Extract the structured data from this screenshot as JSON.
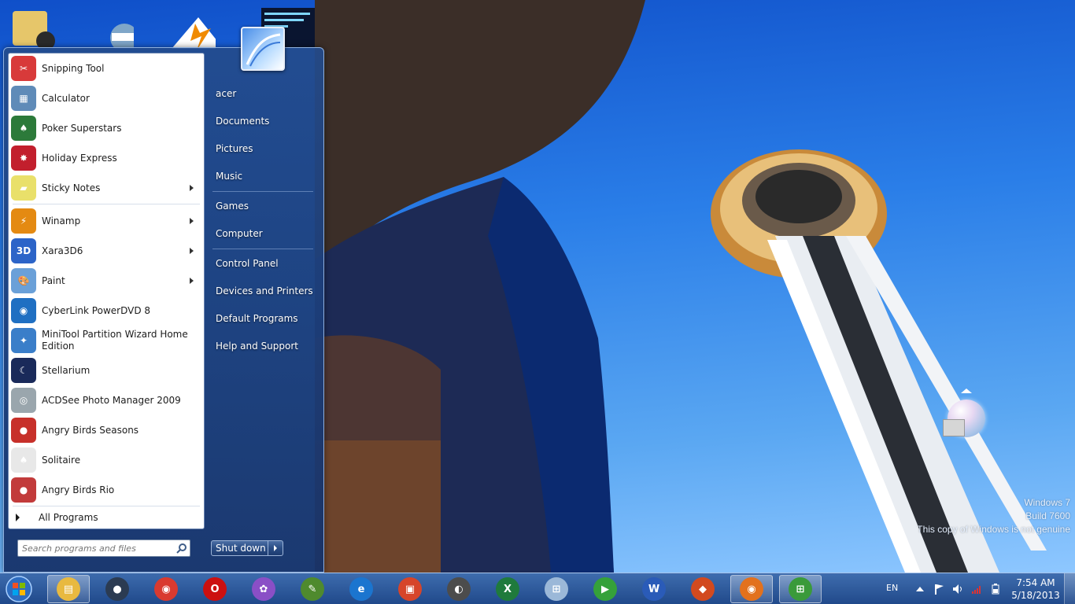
{
  "start_menu": {
    "programs": [
      {
        "label": "Snipping Tool",
        "icon": "scissors-icon",
        "color": "#d83a3a",
        "glyph": "✂",
        "submenu": false
      },
      {
        "label": "Calculator",
        "icon": "calculator-icon",
        "color": "#5f8bb8",
        "glyph": "▦",
        "submenu": false
      },
      {
        "label": "Poker Superstars",
        "icon": "poker-icon",
        "color": "#2c7a3a",
        "glyph": "♠",
        "submenu": false
      },
      {
        "label": "Holiday Express",
        "icon": "holiday-express-icon",
        "color": "#c21f2d",
        "glyph": "✸",
        "submenu": false
      },
      {
        "label": "Sticky Notes",
        "icon": "sticky-notes-icon",
        "color": "#e9e06a",
        "glyph": "▰",
        "submenu": true
      },
      {
        "label": "Winamp",
        "icon": "winamp-icon",
        "color": "#e48a12",
        "glyph": "⚡",
        "submenu": true
      },
      {
        "label": "Xara3D6",
        "icon": "xara3d-icon",
        "color": "#2c64c8",
        "glyph": "3D",
        "submenu": true
      },
      {
        "label": "Paint",
        "icon": "paint-icon",
        "color": "#6aa0d8",
        "glyph": "🎨",
        "submenu": true
      },
      {
        "label": "CyberLink PowerDVD 8",
        "icon": "powerdvd-icon",
        "color": "#1f6fc2",
        "glyph": "◉",
        "submenu": false
      },
      {
        "label": "MiniTool Partition Wizard Home Edition",
        "icon": "partition-wizard-icon",
        "color": "#3a7ec9",
        "glyph": "✦",
        "submenu": false
      },
      {
        "label": "Stellarium",
        "icon": "stellarium-icon",
        "color": "#1a2a5a",
        "glyph": "☾",
        "submenu": false
      },
      {
        "label": "ACDSee Photo Manager 2009",
        "icon": "acdsee-icon",
        "color": "#9aa6ad",
        "glyph": "◎",
        "submenu": false
      },
      {
        "label": "Angry Birds Seasons",
        "icon": "angry-birds-seasons-icon",
        "color": "#c7302a",
        "glyph": "●",
        "submenu": false
      },
      {
        "label": "Solitaire",
        "icon": "solitaire-icon",
        "color": "#e8e8e8",
        "glyph": "♠",
        "submenu": false
      },
      {
        "label": "Angry Birds Rio",
        "icon": "angry-birds-rio-icon",
        "color": "#c23b3b",
        "glyph": "●",
        "submenu": false
      }
    ],
    "all_programs_label": "All Programs",
    "search_placeholder": "Search programs and files",
    "right_items": [
      "acer",
      "Documents",
      "Pictures",
      "Music",
      "Games",
      "Computer",
      "Control Panel",
      "Devices and Printers",
      "Default Programs",
      "Help and Support"
    ],
    "shutdown_label": "Shut down"
  },
  "taskbar": {
    "pinned": [
      {
        "name": "explorer",
        "icon": "folder-icon",
        "color": "#e8b940",
        "glyph": "▤",
        "active": true
      },
      {
        "name": "media",
        "icon": "media-orb-icon",
        "color": "#2b3b52",
        "glyph": "●",
        "active": false
      },
      {
        "name": "chrome",
        "icon": "chrome-icon",
        "color": "#d93a2f",
        "glyph": "◉",
        "active": false
      },
      {
        "name": "opera",
        "icon": "opera-icon",
        "color": "#cc1010",
        "glyph": "O",
        "active": false
      },
      {
        "name": "picasa",
        "icon": "picasa-icon",
        "color": "#8a4fc6",
        "glyph": "✿",
        "active": false
      },
      {
        "name": "pen-tool",
        "icon": "pen-tool-icon",
        "color": "#4f8a2e",
        "glyph": "✎",
        "active": false
      },
      {
        "name": "internet-explorer",
        "icon": "internet-explorer-icon",
        "color": "#1b75cf",
        "glyph": "e",
        "active": false
      },
      {
        "name": "screen-recorder",
        "icon": "recorder-icon",
        "color": "#d6452a",
        "glyph": "▣",
        "active": false
      },
      {
        "name": "sync",
        "icon": "sync-icon",
        "color": "#4c4c4c",
        "glyph": "◐",
        "active": false
      },
      {
        "name": "excel",
        "icon": "excel-icon",
        "color": "#1f7a3c",
        "glyph": "X",
        "active": false
      },
      {
        "name": "windows-tool",
        "icon": "windows-tool-icon",
        "color": "#9bb8d8",
        "glyph": "⊞",
        "active": false
      },
      {
        "name": "green-app",
        "icon": "green-app-icon",
        "color": "#35a13a",
        "glyph": "▶",
        "active": false
      },
      {
        "name": "word",
        "icon": "word-icon",
        "color": "#2a5bb8",
        "glyph": "W",
        "active": false
      },
      {
        "name": "flame-app",
        "icon": "flame-app-icon",
        "color": "#d24a1f",
        "glyph": "◆",
        "active": false
      },
      {
        "name": "firefox",
        "icon": "firefox-icon",
        "color": "#e2711d",
        "glyph": "◉",
        "active": true
      },
      {
        "name": "windows-flag-app",
        "icon": "windows-flag-icon",
        "color": "#3a9a3a",
        "glyph": "⊞",
        "active": true
      }
    ],
    "language": "EN",
    "time": "7:54 AM",
    "date": "5/18/2013"
  },
  "watermark": {
    "line1": "Windows 7",
    "line2": "Build 7600",
    "line3": "This copy of Windows is not genuine"
  },
  "colors": {
    "taskbar": "#2a5a9e",
    "start_menu": "#1f3f78",
    "sky": "#2a7ee8"
  }
}
